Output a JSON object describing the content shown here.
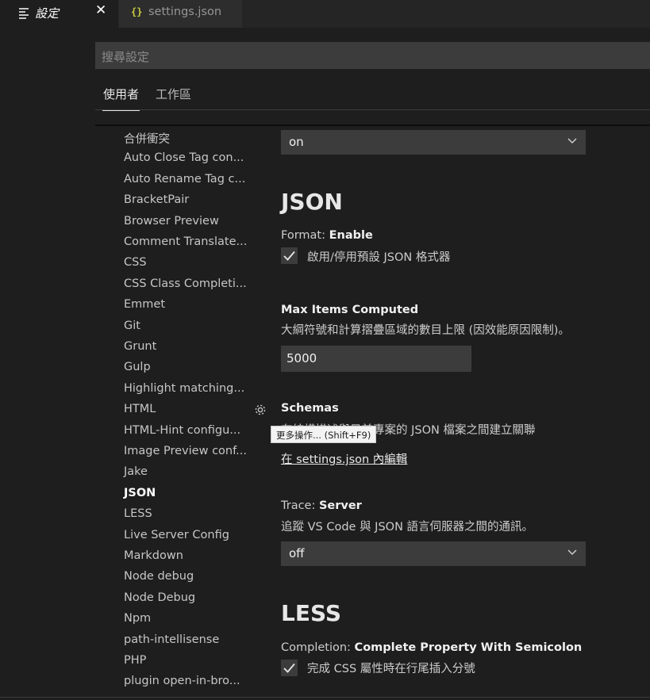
{
  "tabs": {
    "settings_tab": {
      "label": "設定",
      "icon": "settings-editor-icon",
      "close": "✕"
    },
    "json_tab": {
      "label": "settings.json",
      "icon": "json-braces-icon",
      "icon_glyph": "{}"
    }
  },
  "search": {
    "placeholder": "搜尋設定"
  },
  "scope_tabs": {
    "user": "使用者",
    "workspace": "工作區"
  },
  "toc": {
    "items": [
      "合併衝突",
      "Auto Close Tag con...",
      "Auto Rename Tag c...",
      "BracketPair",
      "Browser Preview",
      "Comment Translate...",
      "CSS",
      "CSS Class Completi...",
      "Emmet",
      "Git",
      "Grunt",
      "Gulp",
      "Highlight matching...",
      "HTML",
      "HTML-Hint configu...",
      "Image Preview conf...",
      "Jake",
      "JSON",
      "LESS",
      "Live Server Config",
      "Markdown",
      "Node debug",
      "Node Debug",
      "Npm",
      "path-intellisense",
      "PHP",
      "plugin open-in-bro..."
    ],
    "active_index": 17
  },
  "content": {
    "top_select": {
      "value": "on"
    },
    "json_header": "JSON",
    "format": {
      "category": "Format: ",
      "name": "Enable",
      "checkbox_label": "啟用/停用預設 JSON 格式器",
      "checked": true
    },
    "max_items": {
      "name": "Max Items Computed",
      "description": "大綱符號和計算摺疊區域的數目上限 (因效能原因限制)。",
      "value": "5000"
    },
    "schemas": {
      "name": "Schemas",
      "description": "在結構描述與目前專案的 JSON 檔案之間建立關聯",
      "link": "在 settings.json 內編輯"
    },
    "gear_tooltip": "更多操作... (Shift+F9)",
    "trace": {
      "category": "Trace: ",
      "name": "Server",
      "description": "追蹤 VS Code 與 JSON 語言伺服器之間的通訊。",
      "value": "off"
    },
    "less_header": "LESS",
    "completion": {
      "category": "Completion: ",
      "name": "Complete Property With Semicolon",
      "checkbox_label": "完成 CSS 屬性時在行尾插入分號",
      "checked": true
    }
  },
  "colors": {
    "background": "#1e1e1e",
    "input_bg": "#3c3c3c",
    "tab_bar": "#252526",
    "json_icon": "#cbcb41"
  }
}
